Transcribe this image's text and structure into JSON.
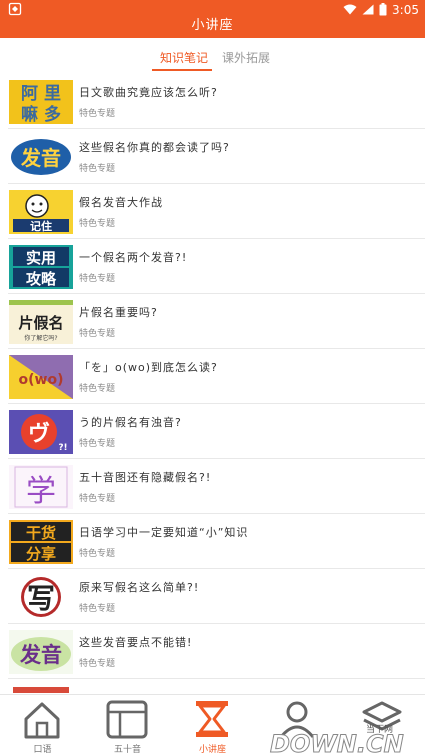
{
  "status_bar": {
    "time": "3:05"
  },
  "header": {
    "title": "小讲座"
  },
  "tabs": [
    {
      "label": "知识笔记",
      "active": true
    },
    {
      "label": "课外拓展",
      "active": false
    }
  ],
  "items": [
    {
      "title": "日文歌曲究竟应该怎么听?",
      "subtitle": "特色专题",
      "thumb_text": [
        "阿 里",
        "嘛 多"
      ]
    },
    {
      "title": "这些假名你真的都会读了吗?",
      "subtitle": "特色专题",
      "thumb_text": [
        "发音"
      ]
    },
    {
      "title": "假名发音大作战",
      "subtitle": "特色专题",
      "thumb_text": [
        "记住"
      ]
    },
    {
      "title": "一个假名两个发音?!",
      "subtitle": "特色专题",
      "thumb_text": [
        "实用",
        "攻略"
      ]
    },
    {
      "title": "片假名重要吗?",
      "subtitle": "特色专题",
      "thumb_text": [
        "片假名",
        "你了解它吗?"
      ]
    },
    {
      "title": "「を」o(wo)到底怎么读?",
      "subtitle": "特色专题",
      "thumb_text": [
        "o(wo)"
      ]
    },
    {
      "title": "う的片假名有浊音?",
      "subtitle": "特色专题",
      "thumb_text": [
        "ヴ",
        "?!"
      ]
    },
    {
      "title": "五十音图还有隐藏假名?!",
      "subtitle": "特色专题",
      "thumb_text": [
        "学"
      ]
    },
    {
      "title": "日语学习中一定要知道“小”知识",
      "subtitle": "特色专题",
      "thumb_text": [
        "干货",
        "分享"
      ]
    },
    {
      "title": "原来写假名这么简单?!",
      "subtitle": "特色专题",
      "thumb_text": [
        "写"
      ]
    },
    {
      "title": "这些发音要点不能错!",
      "subtitle": "特色专题",
      "thumb_text": [
        "发音"
      ]
    }
  ],
  "bottom_nav": [
    {
      "label": "口语",
      "icon": "home-icon",
      "active": false
    },
    {
      "label": "五十音",
      "icon": "grid-icon",
      "active": false
    },
    {
      "label": "小讲座",
      "icon": "hourglass-icon",
      "active": true
    },
    {
      "label": "",
      "icon": "user-icon",
      "active": false
    },
    {
      "label": "",
      "icon": "layers-icon",
      "active": false
    }
  ],
  "watermark": {
    "text": "DOWN.CN",
    "sub": "当下网"
  },
  "colors": {
    "accent": "#ef5a25"
  }
}
